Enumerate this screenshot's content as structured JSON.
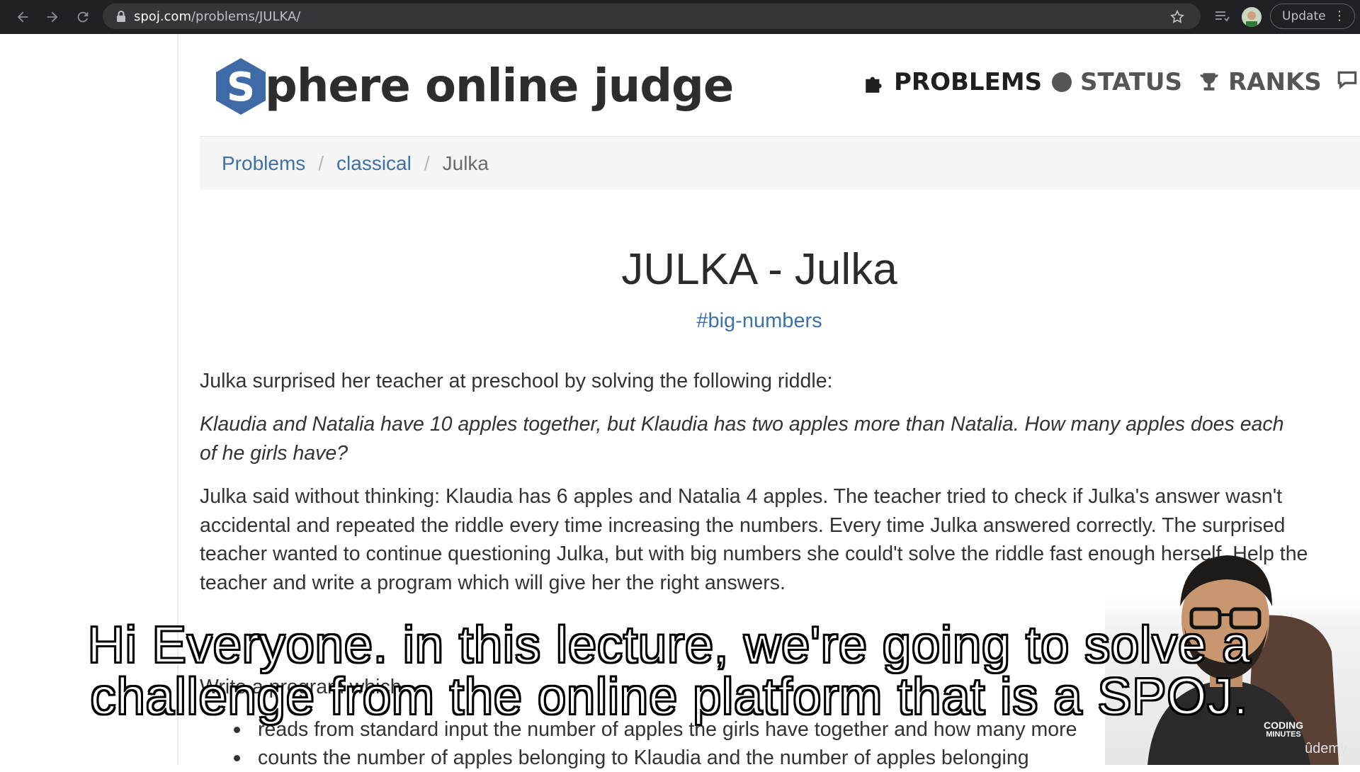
{
  "browser": {
    "url_host": "spoj.com",
    "url_path": "/problems/JULKA/",
    "update_label": "Update"
  },
  "site": {
    "logo_text": "phere online judge",
    "logo_letter": "S",
    "nav": [
      {
        "label": "PROBLEMS",
        "icon": "puzzle-icon"
      },
      {
        "label": "STATUS",
        "icon": "circle-icon"
      },
      {
        "label": "RANKS",
        "icon": "trophy-icon"
      }
    ]
  },
  "breadcrumb": {
    "items": [
      "Problems",
      "classical"
    ],
    "current": "Julka"
  },
  "problem": {
    "title": "JULKA - Julka",
    "tag": "#big-numbers",
    "intro": "Julka surprised her teacher at preschool by solving the following riddle:",
    "riddle": "Klaudia and Natalia have 10 apples together, but Klaudia has two apples more than Natalia. How many apples does each of he girls have?",
    "story": "Julka said without thinking: Klaudia has 6 apples and Natalia 4 apples. The teacher tried to check if Julka's answer wasn't accidental and repeated the riddle every time increasing the numbers. Every time Julka answered correctly. The surprised teacher wanted to continue questioning Julka, but with big numbers she could't solve the riddle fast enough herself. Help the teacher and write a program which will give her the right answers.",
    "task_heading": "Write a program which",
    "task_items": [
      "reads from standard input the number of apples the girls have together and how many more",
      "counts the number of apples belonging to Klaudia and the number of apples belonging"
    ]
  },
  "captions": {
    "line1": "Hi Everyone. in this lecture, we're going to solve a",
    "line2": "challenge from the online platform that is a SPOJ."
  },
  "overlay": {
    "brand_top": "CODING",
    "brand_bottom": "MINUTES",
    "udemy": "ûdemy"
  },
  "colors": {
    "link": "#3d72a8",
    "logo_blue": "#3e6aa7",
    "topbar": "#202124"
  }
}
